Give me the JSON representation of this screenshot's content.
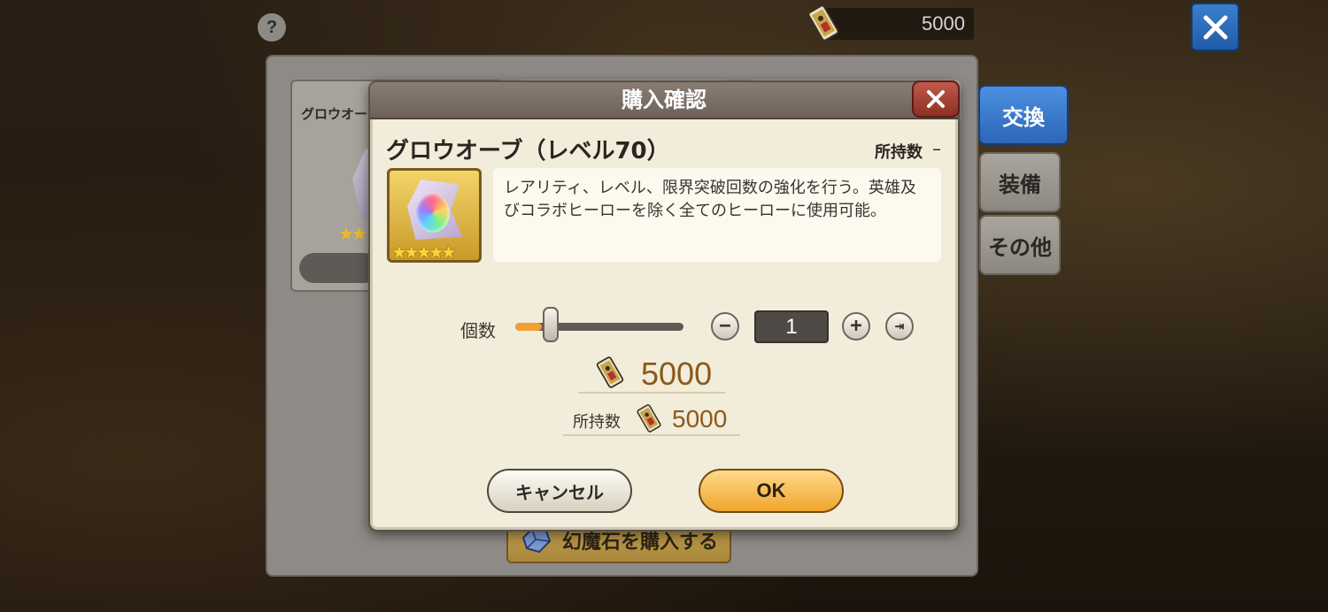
{
  "top_bar": {
    "help_label": "?",
    "currency_value": "5000",
    "currency_icon": "ticket-icon",
    "close_icon": "close-icon"
  },
  "shop": {
    "card_title_partial": "グロウオー",
    "side_tabs": [
      {
        "label": "交換",
        "active": true
      },
      {
        "label": "装備",
        "active": false
      },
      {
        "label": "その他",
        "active": false
      }
    ],
    "buy_stone_label": "幻魔石を購入する"
  },
  "dialog": {
    "title": "購入確認",
    "item_name": "グロウオーブ（レベル70）",
    "owned_label": "所持数",
    "owned_value": "–",
    "description": "レアリティ、レベル、限界突破回数の強化を行う。英雄及びコラボヒーローを除く全てのヒーローに使用可能。",
    "item_stars": "★★★★★",
    "quantity_label": "個数",
    "quantity_value": "1",
    "quantity_fraction": 0.16,
    "minus_label": "−",
    "plus_label": "+",
    "max_label": "⇥",
    "cost_value": "5000",
    "owned2_label": "所持数",
    "owned2_value": "5000",
    "cancel_label": "キャンセル",
    "ok_label": "OK"
  },
  "colors": {
    "accent_blue": "#2c66b8",
    "ok_orange": "#f0a52c",
    "slider_fill": "#f0a030",
    "price_brown": "#8a5a1a"
  }
}
